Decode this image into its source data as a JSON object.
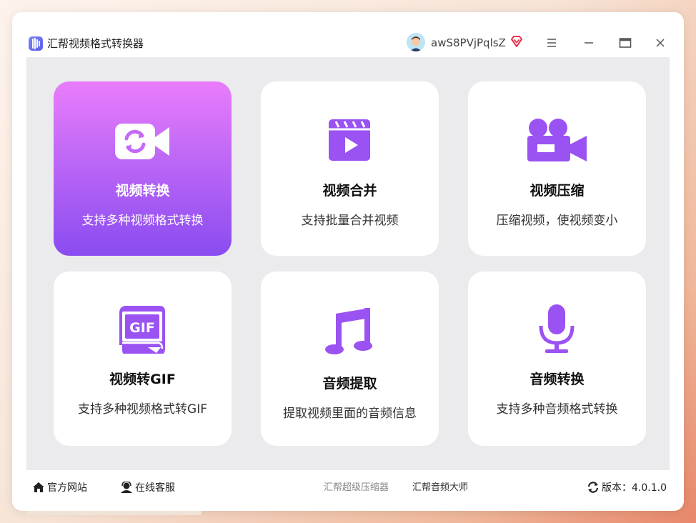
{
  "window": {
    "title": "汇帮视频格式转换器",
    "username": "awS8PVjPqlsZ"
  },
  "colors": {
    "accent": "#9b52f2",
    "active_card_top": "#e97dfb",
    "active_card_bottom": "#8a4cf0",
    "content_bg": "#ebebee"
  },
  "icons": {
    "app": "app-logo-icon",
    "vip": "vip-diamond-icon",
    "menu": "hamburger-menu-icon",
    "minimize": "minimize-icon",
    "maximize": "maximize-icon",
    "close": "close-icon"
  },
  "cards": [
    {
      "title": "视频转换",
      "subtitle": "支持多种视频格式转换",
      "icon": "video-convert-icon",
      "active": true
    },
    {
      "title": "视频合并",
      "subtitle": "支持批量合并视频",
      "icon": "video-clapper-icon",
      "active": false
    },
    {
      "title": "视频压缩",
      "subtitle": "压缩视频，使视频变小",
      "icon": "video-camera-icon",
      "active": false
    },
    {
      "title": "视频转GIF",
      "subtitle": "支持多种视频格式转GIF",
      "icon": "gif-file-icon",
      "active": false
    },
    {
      "title": "音频提取",
      "subtitle": "提取视频里面的音频信息",
      "icon": "music-note-icon",
      "active": false
    },
    {
      "title": "音频转换",
      "subtitle": "支持多种音频格式转换",
      "icon": "microphone-icon",
      "active": false
    }
  ],
  "footer": {
    "website": "官方网站",
    "support": "在线客服",
    "link_compressor": "汇帮超级压缩器",
    "link_audio": "汇帮音频大师",
    "version": "版本：4.0.1.0"
  }
}
